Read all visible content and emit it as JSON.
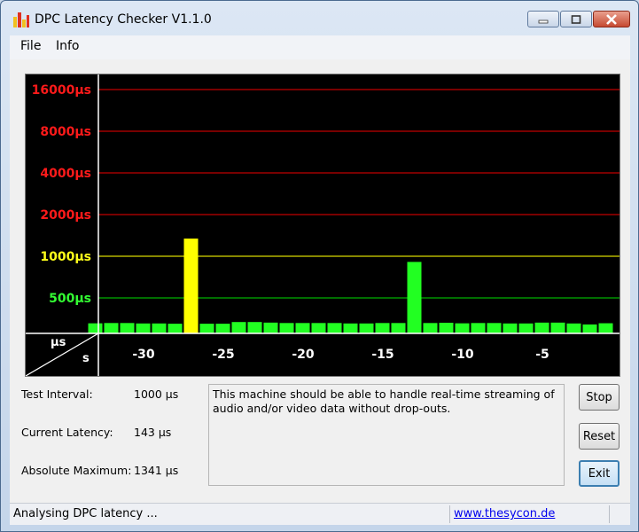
{
  "window": {
    "title": "DPC Latency Checker V1.1.0"
  },
  "menu": {
    "items": [
      "File",
      "Info"
    ]
  },
  "graph": {
    "y_labels": [
      {
        "text": "16000µs",
        "color": "#ff1a1a"
      },
      {
        "text": "8000µs",
        "color": "#ff1a1a"
      },
      {
        "text": "4000µs",
        "color": "#ff1a1a"
      },
      {
        "text": "2000µs",
        "color": "#ff1a1a"
      },
      {
        "text": "1000µs",
        "color": "#ffff1a"
      },
      {
        "text": "500µs",
        "color": "#33ff33"
      }
    ],
    "corner_top": "µs",
    "corner_bottom": "s",
    "x_labels": [
      "-30",
      "-25",
      "-20",
      "-15",
      "-10",
      "-5"
    ],
    "bar_color_normal": "#22ff22",
    "bar_color_warning": "#ffff00"
  },
  "chart_data": {
    "type": "bar",
    "title": "",
    "xlabel": "s",
    "ylabel": "µs",
    "x_ticks": [
      -30,
      -25,
      -20,
      -15,
      -10,
      -5
    ],
    "y_ticks_us": [
      500,
      1000,
      2000,
      4000,
      8000,
      16000
    ],
    "y_scale": "log2",
    "x": [
      -33,
      -32,
      -31,
      -30,
      -29,
      -28,
      -27,
      -26,
      -25,
      -24,
      -23,
      -22,
      -21,
      -20,
      -19,
      -18,
      -17,
      -16,
      -15,
      -14,
      -13,
      -12,
      -11,
      -10,
      -9,
      -8,
      -7,
      -6,
      -5,
      -4,
      -3,
      -2,
      -1
    ],
    "values_us": [
      142,
      146,
      146,
      140,
      140,
      136,
      1341,
      136,
      136,
      160,
      160,
      152,
      146,
      146,
      146,
      146,
      140,
      140,
      146,
      146,
      910,
      146,
      150,
      142,
      146,
      146,
      140,
      140,
      152,
      152,
      140,
      126,
      143
    ],
    "value_colors": [
      "g",
      "g",
      "g",
      "g",
      "g",
      "g",
      "y",
      "g",
      "g",
      "g",
      "g",
      "g",
      "g",
      "g",
      "g",
      "g",
      "g",
      "g",
      "g",
      "g",
      "g",
      "g",
      "g",
      "g",
      "g",
      "g",
      "g",
      "g",
      "g",
      "g",
      "g",
      "g",
      "g"
    ]
  },
  "info": {
    "test_interval_label": "Test Interval:",
    "test_interval_value": "1000 µs",
    "current_latency_label": "Current Latency:",
    "current_latency_value": "143 µs",
    "absolute_maximum_label": "Absolute Maximum:",
    "absolute_maximum_value": "1341 µs",
    "message": "This machine should be able to handle real-time streaming of audio and/or video data without drop-outs."
  },
  "buttons": {
    "stop": "Stop",
    "reset": "Reset",
    "exit": "Exit"
  },
  "status": {
    "text": "Analysing DPC latency ...",
    "link": "www.thesycon.de"
  }
}
